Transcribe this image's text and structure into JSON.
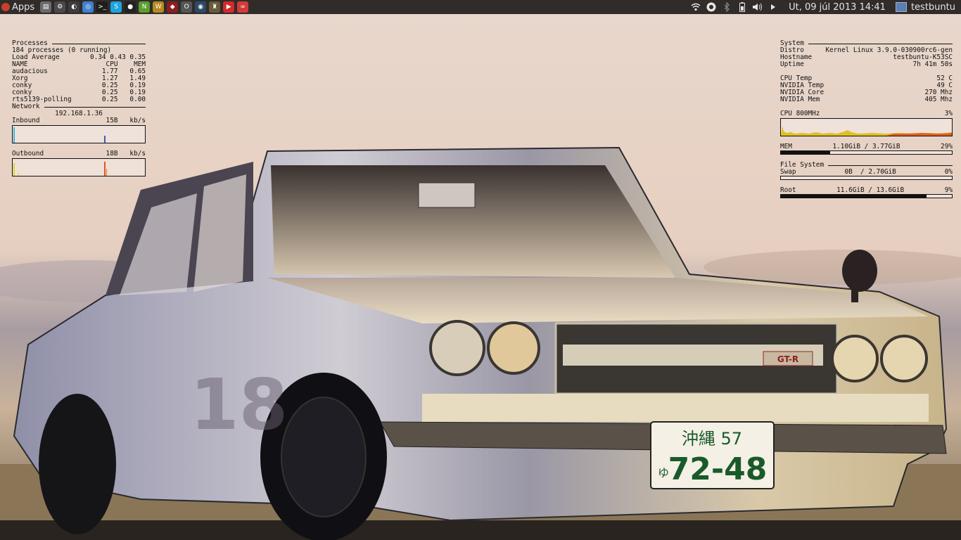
{
  "panel": {
    "apps_label": "Apps",
    "launchers": [
      {
        "icon": "files-icon",
        "color": "#6b6b6b",
        "glyph": "▤"
      },
      {
        "icon": "settings-icon",
        "color": "#4a4a4a",
        "glyph": "⚙"
      },
      {
        "icon": "volume-icon",
        "color": "#3c3c3c",
        "glyph": "◐"
      },
      {
        "icon": "chromium-icon",
        "color": "#3f7fd0",
        "glyph": "◎"
      },
      {
        "icon": "terminal-icon",
        "color": "#1e1e1e",
        "glyph": ">_"
      },
      {
        "icon": "skype-icon",
        "color": "#1ea3e0",
        "glyph": "S"
      },
      {
        "icon": "ubuntu-one-icon",
        "color": "#222",
        "glyph": "●"
      },
      {
        "icon": "nvidia-icon",
        "color": "#5c9d2e",
        "glyph": "N"
      },
      {
        "icon": "wow-icon",
        "color": "#b58a1f",
        "glyph": "W"
      },
      {
        "icon": "app-icon",
        "color": "#8a1f1f",
        "glyph": "◆"
      },
      {
        "icon": "office-icon",
        "color": "#555",
        "glyph": "O"
      },
      {
        "icon": "steam-icon",
        "color": "#2b4a68",
        "glyph": "◉"
      },
      {
        "icon": "game-icon",
        "color": "#6a5a3a",
        "glyph": "♜"
      },
      {
        "icon": "youtube-icon",
        "color": "#d32a2a",
        "glyph": "▶"
      },
      {
        "icon": "link-icon",
        "color": "#d23a3a",
        "glyph": "∞"
      }
    ],
    "clock": "Ut, 09 júl 2013 14:41",
    "user": "testbuntu"
  },
  "conky_left": {
    "processes_title": "Processes",
    "process_count": "184 processes (0 running)",
    "load_label": "Load Average",
    "load_values": "0.34 0.43 0.35",
    "col_name": "NAME",
    "col_cpu": "CPU",
    "col_mem": "MEM",
    "processes": [
      {
        "name": "audacious",
        "cpu": "1.77",
        "mem": "0.65"
      },
      {
        "name": "Xorg",
        "cpu": "1.27",
        "mem": "1.49"
      },
      {
        "name": "conky",
        "cpu": "0.25",
        "mem": "0.19"
      },
      {
        "name": "conky",
        "cpu": "0.25",
        "mem": "0.19"
      },
      {
        "name": "rts5139-polling",
        "cpu": "0.25",
        "mem": "0.00"
      }
    ],
    "network_title": "Network",
    "ip": "192.168.1.36",
    "inbound_label": "Inbound",
    "inbound_value": "15B",
    "inbound_unit": "kb/s",
    "outbound_label": "Outbound",
    "outbound_value": "18B",
    "outbound_unit": "kb/s"
  },
  "conky_right": {
    "system_title": "System",
    "distro_label": "Distro",
    "distro_value": "Kernel Linux 3.9.0-030900rc6-gen",
    "hostname_label": "Hostname",
    "hostname_value": "testbuntu-K53SC",
    "uptime_label": "Uptime",
    "uptime_value": "7h 41m 50s",
    "cpu_temp_label": "CPU Temp",
    "cpu_temp_value": "52 C",
    "nv_temp_label": "NVIDIA Temp",
    "nv_temp_value": "49 C",
    "nv_core_label": "NVIDIA Core",
    "nv_core_value": "270 Mhz",
    "nv_mem_label": "NVIDIA Mem",
    "nv_mem_value": "405 Mhz",
    "cpu_label": "CPU 800MHz",
    "cpu_percent": "3%",
    "mem_label": "MEM",
    "mem_value": "1.10GiB / 3.77GiB",
    "mem_percent": "29%",
    "mem_fraction": 0.29,
    "fs_title": "File System",
    "swap_label": "Swap",
    "swap_value": "0B  / 2.70GiB",
    "swap_percent": "0%",
    "swap_fraction": 0.0,
    "root_label": "Root",
    "root_value": "11.6GiB / 13.6GiB",
    "root_percent": "9%",
    "root_fraction": 0.85
  },
  "wallpaper": {
    "plate_top": "沖縄 57",
    "plate_kana": "ゆ",
    "plate_number": "72-48",
    "badge": "GT-R"
  }
}
